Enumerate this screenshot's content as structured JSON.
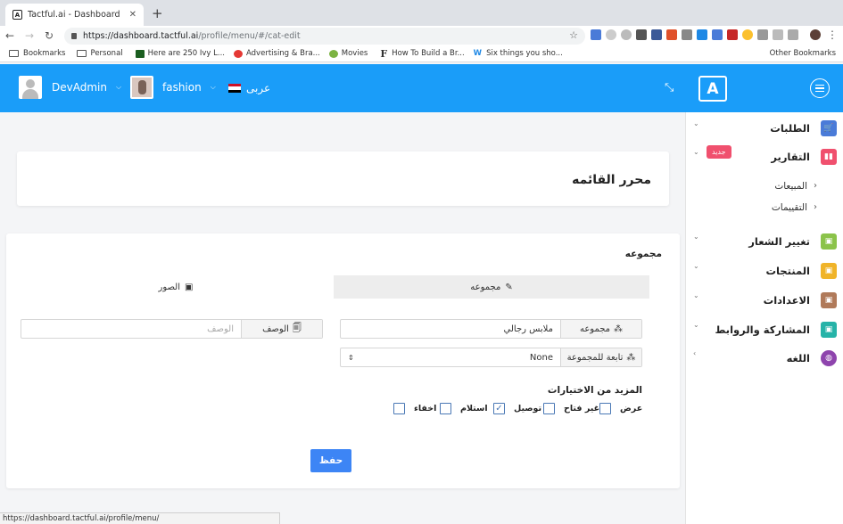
{
  "browser": {
    "tab_title": "Tactful.ai - Dashboard",
    "tab_favicon": "A",
    "url_host": "https://dashboard.tactful.ai",
    "url_path": "/profile/menu/#/cat-edit",
    "status_url": "https://dashboard.tactful.ai/profile/menu/"
  },
  "bookmarks": {
    "items": [
      "Bookmarks",
      "Personal",
      "Here are 250 Ivy L...",
      "Advertising & Bra...",
      "Movies",
      "How To Build a Br...",
      "Six things you sho..."
    ],
    "other": "Other Bookmarks"
  },
  "header": {
    "user1": "DevAdmin",
    "user2": "fashion",
    "language": "عربى",
    "logo": "A",
    "accent": "#1a9df9"
  },
  "sidebar": {
    "items": [
      {
        "label": "الطلبات",
        "icon": "cart-icon",
        "color": "#4a7bd8"
      },
      {
        "label": "التقارير",
        "icon": "bar-chart-icon",
        "color": "#f0506e"
      },
      {
        "label": "تغيير الشعار",
        "icon": "image-icon",
        "color": "#8bc34a"
      },
      {
        "label": "المنتجات",
        "icon": "box-icon",
        "color": "#f0b429"
      },
      {
        "label": "الاعدادات",
        "icon": "settings-icon",
        "color": "#b07a5a"
      },
      {
        "label": "المشاركة والروابط",
        "icon": "share-icon",
        "color": "#26b3a8"
      },
      {
        "label": "اللغه",
        "icon": "globe-icon",
        "color": "#8e44ad"
      }
    ],
    "badge": "جديد",
    "subitems": [
      "المبيعات",
      "التقييمات"
    ]
  },
  "page": {
    "title": "محرر القائمه",
    "section": "مجموعه",
    "tab_group": "مجموعه",
    "tab_images": "الصور",
    "group_label": "مجموعه",
    "group_value": "ملابس رجالي",
    "parent_label": "تابعة للمجموعة",
    "parent_value": "None",
    "desc_label": "الوصف",
    "desc_placeholder": "الوصف",
    "more_options": "المزيد من الاختيارات",
    "options": [
      {
        "label": "عرض",
        "checked": false
      },
      {
        "label": "غير فتاح",
        "checked": false
      },
      {
        "label": "توصيل",
        "checked": true
      },
      {
        "label": "استلام",
        "checked": false
      },
      {
        "label": "اخفاء",
        "checked": false
      }
    ],
    "save": "حفظ"
  }
}
